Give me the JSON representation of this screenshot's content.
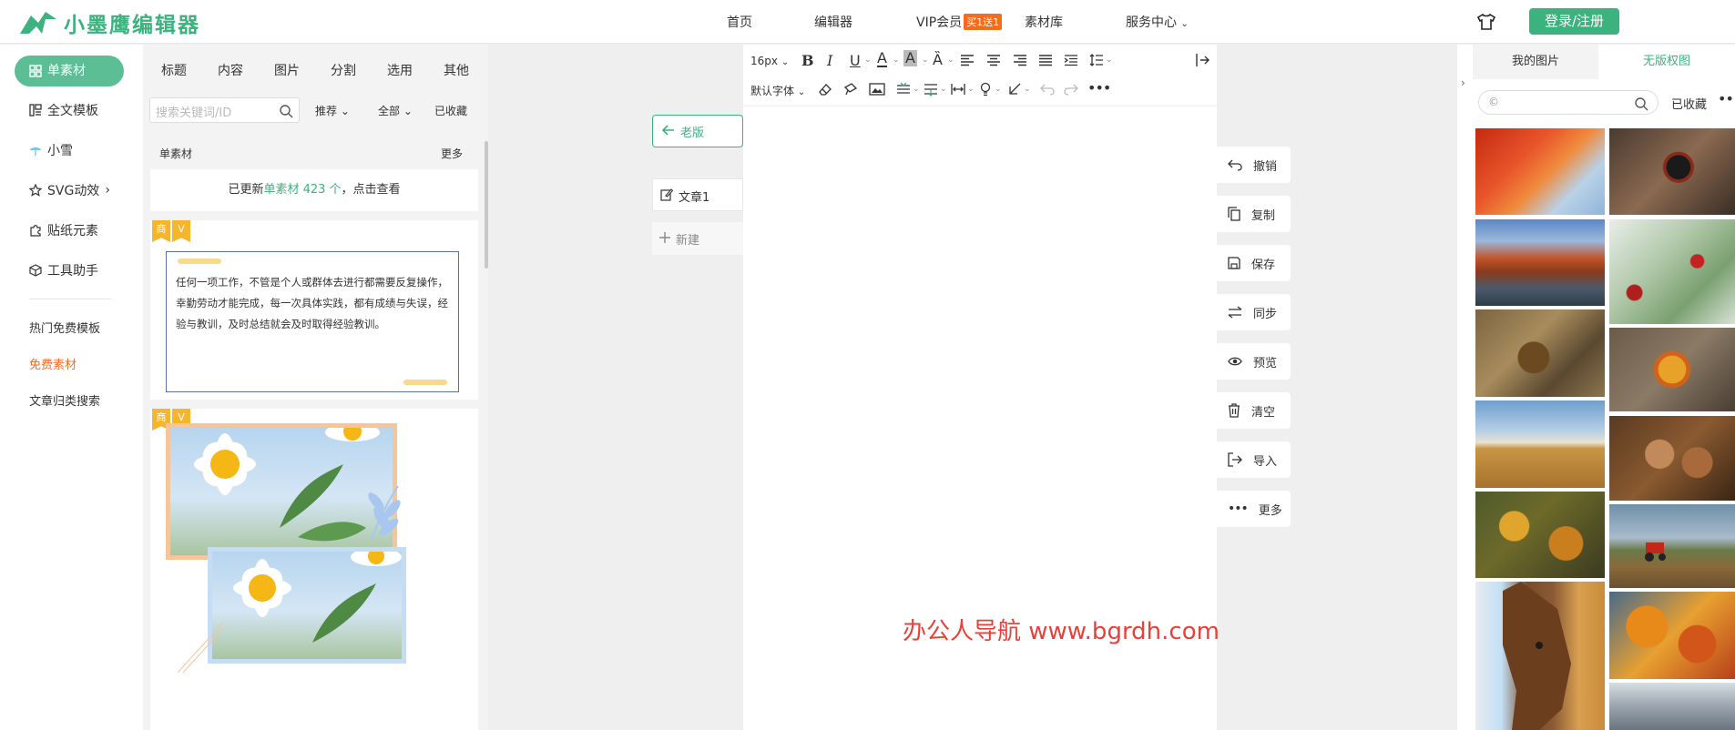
{
  "header": {
    "logo_text": "小墨鹰编辑器",
    "nav": [
      "首页",
      "编辑器",
      "VIP会员",
      "素材库",
      "服务中心"
    ],
    "vip_badge": "买1送1",
    "login_label": "登录/注册"
  },
  "leftnav": {
    "items": [
      "单素材",
      "全文模板",
      "小雪",
      "SVG动效",
      "贴纸元素",
      "工具助手"
    ],
    "links": [
      "热门免费模板",
      "免费素材",
      "文章归类搜索"
    ]
  },
  "materials": {
    "tabs": [
      "标题",
      "内容",
      "图片",
      "分割",
      "选用",
      "其他"
    ],
    "search_placeholder": "搜索关键词/ID",
    "filter_sort": "推荐",
    "filter_all": "全部",
    "collected": "已收藏",
    "section_title": "单素材",
    "more": "更多",
    "update_prefix": "已更新",
    "update_link": "单素材 423 个",
    "update_suffix": "，点击查看",
    "badge_business": "商",
    "badge_vip": "V",
    "sample_text": "任何一项工作，不管是个人或群体去进行都需要反复操作，幸勤劳动才能完成，每一次具体实践，都有成绩与失误，经验与教训，及时总结就会及时取得经验教训。"
  },
  "editor": {
    "old_version": "老版",
    "article_tab": "文章1",
    "new_article": "新建",
    "font_size": "16px",
    "font_family": "默认字体",
    "watermark": "办公人导航 www.bgrdh.com"
  },
  "side_actions": [
    "撤销",
    "复制",
    "保存",
    "同步",
    "预览",
    "清空",
    "导入",
    "更多"
  ],
  "right_panel": {
    "tab_my_images": "我的图片",
    "tab_free_images": "无版权图",
    "search_prefix": "©",
    "collected": "已收藏",
    "more": "•••"
  },
  "colors": {
    "brand": "#3cb27f",
    "vip_badge": "#f76b1c",
    "watermark": "#e8403a"
  }
}
